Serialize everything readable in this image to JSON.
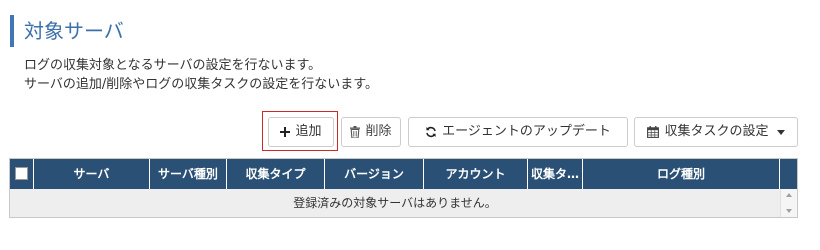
{
  "page": {
    "title": "対象サーバ",
    "description_line1": "ログの収集対象となるサーバの設定を行ないます。",
    "description_line2": "サーバの追加/削除やログの収集タスクの設定を行ないます。"
  },
  "toolbar": {
    "add_label": "追加",
    "delete_label": "削除",
    "update_agent_label": "エージェントのアップデート",
    "collection_task_settings_label": "収集タスクの設定"
  },
  "grid": {
    "columns": [
      "サーバ",
      "サーバ種別",
      "収集タイプ",
      "バージョン",
      "アカウント",
      "収集タ…",
      "ログ種別"
    ],
    "empty_message": "登録済みの対象サーバはありません。"
  },
  "icons": {
    "add": "plus-icon",
    "delete": "trash-icon",
    "update": "refresh-icon",
    "settings": "calendar-icon",
    "dropdown": "caret-down-icon"
  },
  "colors": {
    "title_accent": "#3f78b5",
    "header_background": "#2a5075",
    "highlight_border": "#cc2a2a"
  }
}
